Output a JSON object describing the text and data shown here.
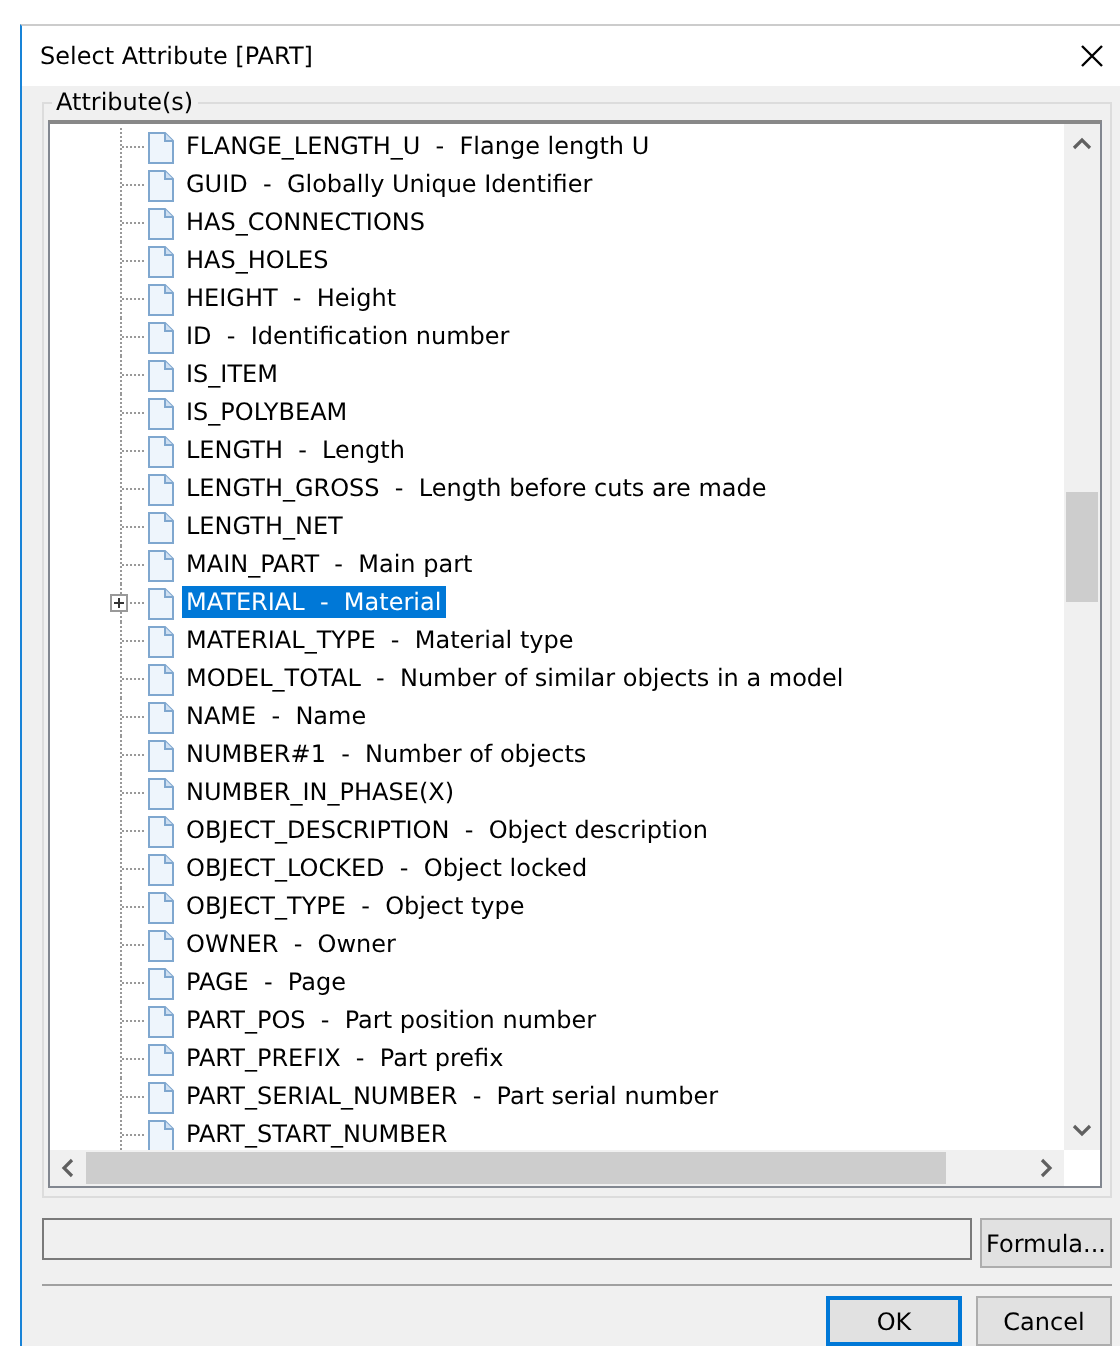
{
  "window": {
    "title": "Select Attribute [PART]"
  },
  "group": {
    "label": "Attribute(s)"
  },
  "attributes": [
    {
      "label": "FLANGE_LENGTH_U  -  Flange length U",
      "expandable": false,
      "selected": false
    },
    {
      "label": "GUID  -  Globally Unique Identifier",
      "expandable": false,
      "selected": false
    },
    {
      "label": "HAS_CONNECTIONS",
      "expandable": false,
      "selected": false
    },
    {
      "label": "HAS_HOLES",
      "expandable": false,
      "selected": false
    },
    {
      "label": "HEIGHT  -  Height",
      "expandable": false,
      "selected": false
    },
    {
      "label": "ID  -  Identification number",
      "expandable": false,
      "selected": false
    },
    {
      "label": "IS_ITEM",
      "expandable": false,
      "selected": false
    },
    {
      "label": "IS_POLYBEAM",
      "expandable": false,
      "selected": false
    },
    {
      "label": "LENGTH  -  Length",
      "expandable": false,
      "selected": false
    },
    {
      "label": "LENGTH_GROSS  -  Length before cuts are made",
      "expandable": false,
      "selected": false
    },
    {
      "label": "LENGTH_NET",
      "expandable": false,
      "selected": false
    },
    {
      "label": "MAIN_PART  -  Main part",
      "expandable": false,
      "selected": false
    },
    {
      "label": "MATERIAL  -  Material",
      "expandable": true,
      "selected": true
    },
    {
      "label": "MATERIAL_TYPE  -  Material type",
      "expandable": false,
      "selected": false
    },
    {
      "label": "MODEL_TOTAL  -  Number of similar objects in a model",
      "expandable": false,
      "selected": false
    },
    {
      "label": "NAME  -  Name",
      "expandable": false,
      "selected": false
    },
    {
      "label": "NUMBER#1  -  Number of objects",
      "expandable": false,
      "selected": false
    },
    {
      "label": "NUMBER_IN_PHASE(X)",
      "expandable": false,
      "selected": false
    },
    {
      "label": "OBJECT_DESCRIPTION  -  Object description",
      "expandable": false,
      "selected": false
    },
    {
      "label": "OBJECT_LOCKED  -  Object locked",
      "expandable": false,
      "selected": false
    },
    {
      "label": "OBJECT_TYPE  -  Object type",
      "expandable": false,
      "selected": false
    },
    {
      "label": "OWNER  -  Owner",
      "expandable": false,
      "selected": false
    },
    {
      "label": "PAGE  -  Page",
      "expandable": false,
      "selected": false
    },
    {
      "label": "PART_POS  -  Part position number",
      "expandable": false,
      "selected": false
    },
    {
      "label": "PART_PREFIX  -  Part prefix",
      "expandable": false,
      "selected": false
    },
    {
      "label": "PART_SERIAL_NUMBER  -  Part serial number",
      "expandable": false,
      "selected": false
    },
    {
      "label": "PART_START_NUMBER",
      "expandable": false,
      "selected": false
    }
  ],
  "buttons": [
    {
      "kind": "formula",
      "label": "Formula...",
      "default": false
    },
    {
      "kind": "ok",
      "label": "OK",
      "default": true
    },
    {
      "kind": "cancel",
      "label": "Cancel",
      "default": false
    }
  ]
}
